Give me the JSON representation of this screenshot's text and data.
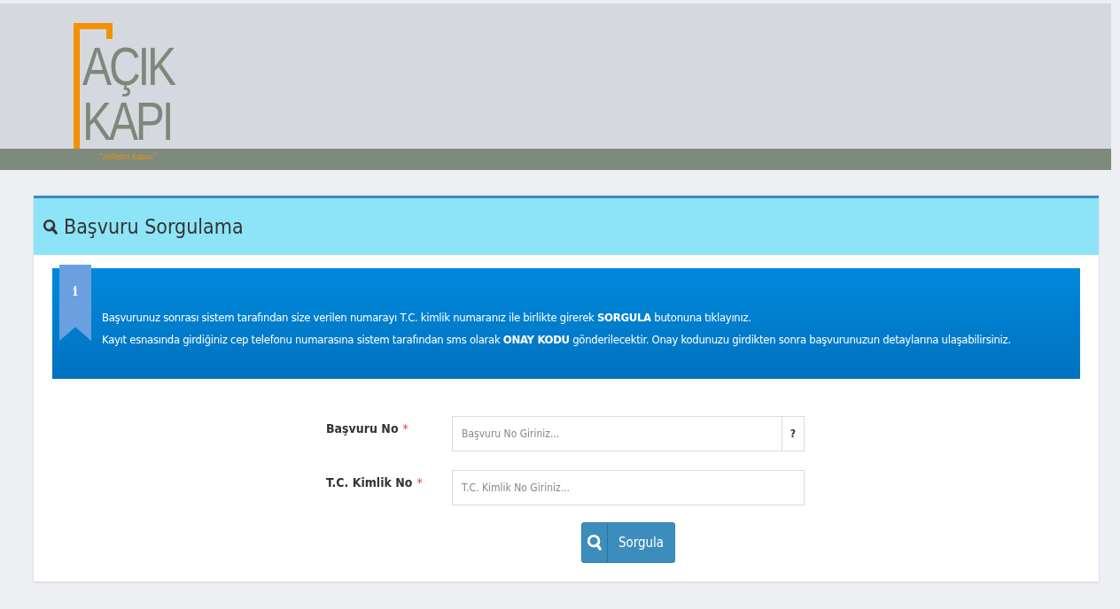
{
  "logo": {
    "line_1": "AÇIK",
    "line_2": "KAPI",
    "tagline": "“milletin kapısı”"
  },
  "panel": {
    "title": "Başvuru Sorgulama"
  },
  "info": {
    "icon": "i",
    "lines": [
      "Başvurunuz sonrası sistem tarafından size verilen numarayı T.C. kimlik numaranız ile birlikte girerek **SORGULA** butonuna tıklayınız.",
      "Kayıt esnasında girdiğiniz cep telefonu numarasına sistem tarafından sms olarak **ONAY KODU** gönderilecektir. Onay kodunuzu girdikten sonra başvurunuzun detaylarına ulaşabilirsiniz."
    ]
  },
  "fields": [
    {
      "label": "Başvuru No",
      "required": "*",
      "placeholder": "Başvuru No Giriniz...",
      "help": "?"
    },
    {
      "label": "T.C. Kimlik No",
      "required": "*",
      "placeholder": "T.C. Kimlik No Giriniz..."
    }
  ],
  "submit": {
    "label": "Sorgula"
  }
}
